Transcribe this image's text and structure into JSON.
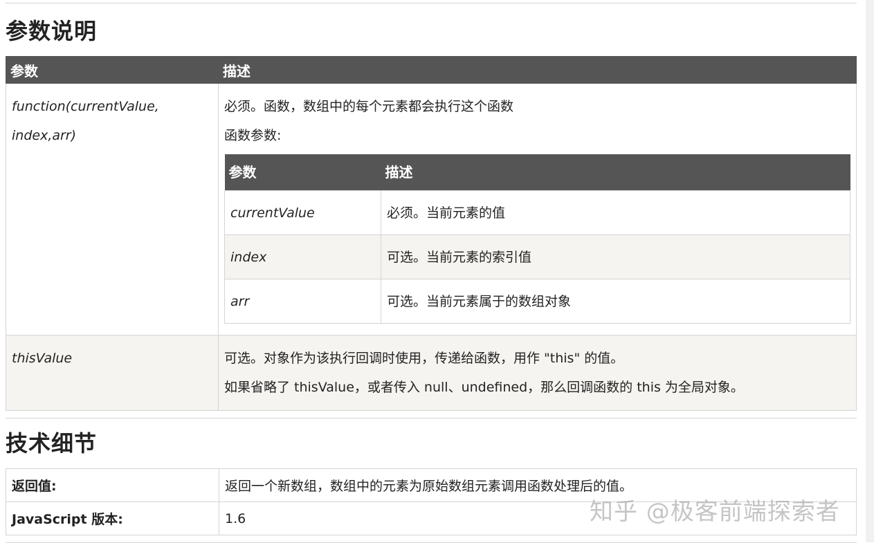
{
  "section1": {
    "title": "参数说明",
    "header": {
      "param": "参数",
      "desc": "描述"
    },
    "row1": {
      "param_line1": "function(currentValue,",
      "param_line2": "index,arr)",
      "desc_line1": "必须。函数，数组中的每个元素都会执行这个函数",
      "desc_line2": "函数参数:",
      "inner": {
        "header": {
          "param": "参数",
          "desc": "描述"
        },
        "rows": [
          {
            "param": "currentValue",
            "desc": "必须。当前元素的值"
          },
          {
            "param": "index",
            "desc": "可选。当前元素的索引值"
          },
          {
            "param": "arr",
            "desc": "可选。当前元素属于的数组对象"
          }
        ]
      }
    },
    "row2": {
      "param": "thisValue",
      "desc_line1": "可选。对象作为该执行回调时使用，传递给函数，用作 \"this\" 的值。",
      "desc_line2": "如果省略了 thisValue，或者传入 null、undefined，那么回调函数的 this 为全局对象。"
    }
  },
  "section2": {
    "title": "技术细节",
    "rows": [
      {
        "key": "返回值:",
        "value": "返回一个新数组，数组中的元素为原始数组元素调用函数处理后的值。"
      },
      {
        "key": "JavaScript 版本:",
        "value": "1.6"
      }
    ]
  },
  "watermark": "知乎 @极客前端探索者"
}
